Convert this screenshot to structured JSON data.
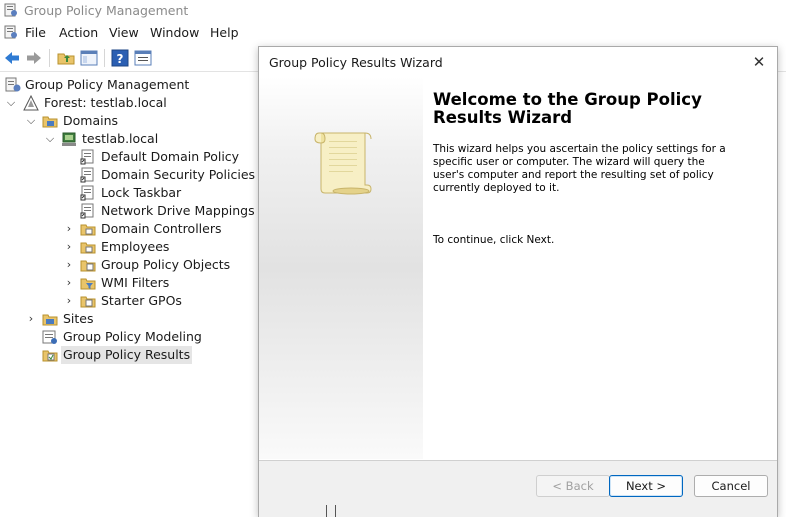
{
  "app": {
    "title": "Group Policy Management"
  },
  "menu": [
    "File",
    "Action",
    "View",
    "Window",
    "Help"
  ],
  "toolbar": {
    "icons": [
      "back-arrow-icon",
      "forward-arrow-icon",
      "up-folder-icon",
      "show-hide-tree-icon",
      "help-icon",
      "properties-icon"
    ]
  },
  "tree": {
    "root": "Group Policy Management",
    "forest": "Forest: testlab.local",
    "domains": "Domains",
    "domain": "testlab.local",
    "gpo_links": [
      "Default Domain Policy",
      "Domain Security Policies",
      "Lock Taskbar",
      "Network Drive Mappings"
    ],
    "containers": [
      "Domain Controllers",
      "Employees",
      "Group Policy Objects",
      "WMI Filters",
      "Starter GPOs"
    ],
    "sites": "Sites",
    "modeling": "Group Policy Modeling",
    "results": "Group Policy Results"
  },
  "dialog": {
    "title": "Group Policy Results Wizard",
    "heading": "Welcome to the Group Policy Results Wizard",
    "description": "This wizard helps you ascertain the policy settings for a specific user or computer. The wizard will query the user's computer and report the resulting set of policy currently deployed to it.",
    "continue_text": "To continue, click Next.",
    "back_label": "< Back",
    "next_label": "Next >",
    "cancel_label": "Cancel"
  },
  "colors": {
    "accent": "#0067c0",
    "selection": "#e5e5e5",
    "folder": "#e9c46a"
  }
}
